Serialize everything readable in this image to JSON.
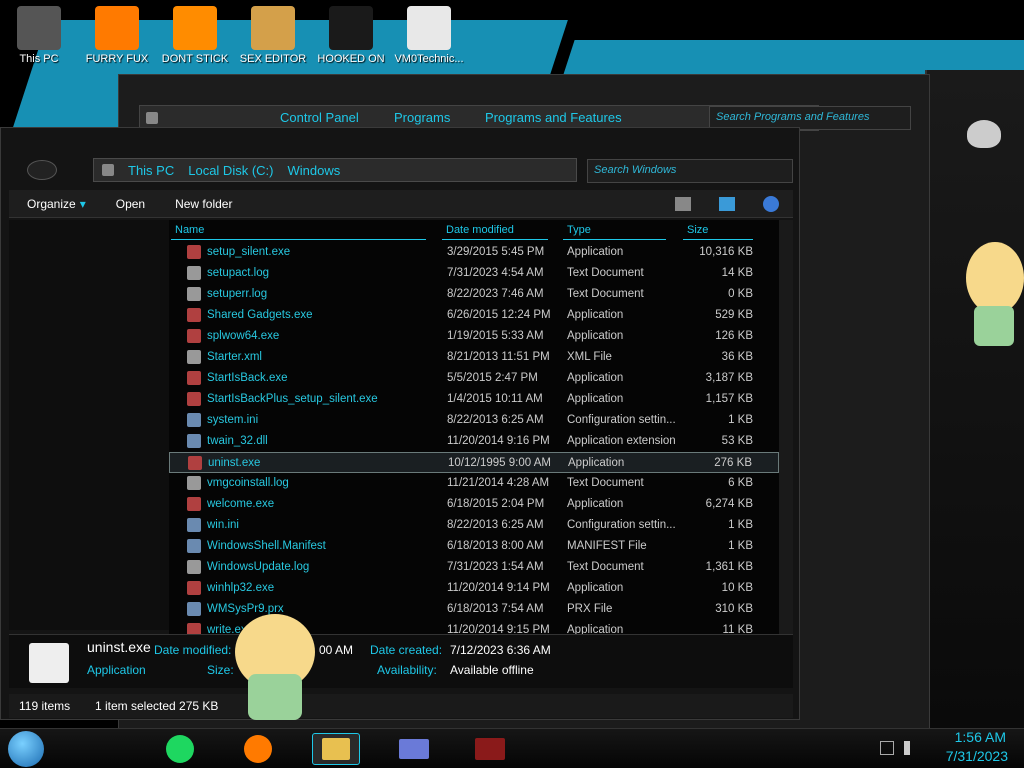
{
  "desktop": {
    "icons": [
      {
        "label": "This PC",
        "icon": "computer-icon",
        "color": "#555555"
      },
      {
        "label": "FURRY FUX",
        "icon": "firefox-icon",
        "color": "#ff7a00"
      },
      {
        "label": "DONT STICK",
        "icon": "vlc-icon",
        "color": "#ff8c00"
      },
      {
        "label": "SEX EDITOR",
        "icon": "hxd-icon",
        "color": "#d4a04a"
      },
      {
        "label": "HOOKED ON",
        "icon": "game-icon",
        "color": "#1a1a1a"
      },
      {
        "label": "VM0Technic...",
        "icon": "doctor-icon",
        "color": "#e8e8e8"
      }
    ]
  },
  "back_window": {
    "crumbs": [
      "Control Panel",
      "Programs",
      "Programs and Features"
    ],
    "search_placeholder": "Search Programs and Features"
  },
  "window": {
    "crumbs": [
      "This PC",
      "Local Disk (C:)",
      "Windows"
    ],
    "search_placeholder": "Search Windows",
    "toolbar": {
      "organize": "Organize",
      "open": "Open",
      "new_folder": "New folder"
    },
    "columns": {
      "name": "Name",
      "date": "Date modified",
      "type": "Type",
      "size": "Size"
    },
    "files": [
      {
        "name": "setup_silent.exe",
        "date": "3/29/2015 5:45 PM",
        "type": "Application",
        "size": "10,316 KB"
      },
      {
        "name": "setupact.log",
        "date": "7/31/2023 4:54 AM",
        "type": "Text Document",
        "size": "14 KB"
      },
      {
        "name": "setuperr.log",
        "date": "8/22/2023 7:46 AM",
        "type": "Text Document",
        "size": "0 KB"
      },
      {
        "name": "Shared Gadgets.exe",
        "date": "6/26/2015 12:24 PM",
        "type": "Application",
        "size": "529 KB"
      },
      {
        "name": "splwow64.exe",
        "date": "1/19/2015 5:33 AM",
        "type": "Application",
        "size": "126 KB"
      },
      {
        "name": "Starter.xml",
        "date": "8/21/2013 11:51 PM",
        "type": "XML File",
        "size": "36 KB"
      },
      {
        "name": "StartIsBack.exe",
        "date": "5/5/2015 2:47 PM",
        "type": "Application",
        "size": "3,187 KB"
      },
      {
        "name": "StartIsBackPlus_setup_silent.exe",
        "date": "1/4/2015 10:11 AM",
        "type": "Application",
        "size": "1,157 KB"
      },
      {
        "name": "system.ini",
        "date": "8/22/2013 6:25 AM",
        "type": "Configuration settin...",
        "size": "1 KB"
      },
      {
        "name": "twain_32.dll",
        "date": "11/20/2014 9:16 PM",
        "type": "Application extension",
        "size": "53 KB"
      },
      {
        "name": "uninst.exe",
        "date": "10/12/1995 9:00 AM",
        "type": "Application",
        "size": "276 KB"
      },
      {
        "name": "vmgcoinstall.log",
        "date": "11/21/2014 4:28 AM",
        "type": "Text Document",
        "size": "6 KB"
      },
      {
        "name": "welcome.exe",
        "date": "6/18/2015 2:04 PM",
        "type": "Application",
        "size": "6,274 KB"
      },
      {
        "name": "win.ini",
        "date": "8/22/2013 6:25 AM",
        "type": "Configuration settin...",
        "size": "1 KB"
      },
      {
        "name": "WindowsShell.Manifest",
        "date": "6/18/2013 8:00 AM",
        "type": "MANIFEST File",
        "size": "1 KB"
      },
      {
        "name": "WindowsUpdate.log",
        "date": "7/31/2023 1:54 AM",
        "type": "Text Document",
        "size": "1,361 KB"
      },
      {
        "name": "winhlp32.exe",
        "date": "11/20/2014 9:14 PM",
        "type": "Application",
        "size": "10 KB"
      },
      {
        "name": "WMSysPr9.prx",
        "date": "6/18/2013 7:54 AM",
        "type": "PRX File",
        "size": "310 KB"
      },
      {
        "name": "write.exe",
        "date": "11/20/2014 9:15 PM",
        "type": "Application",
        "size": "11 KB"
      }
    ],
    "details": {
      "filename": "uninst.exe",
      "kind": "Application",
      "date_modified_label": "Date modified:",
      "date_modified_value": "00 AM",
      "size_label": "Size:",
      "date_created_label": "Date created:",
      "date_created_value": "7/12/2023 6:36 AM",
      "availability_label": "Availability:",
      "availability_value": "Available offline"
    },
    "status": {
      "items": "119 items",
      "selected": "1 item selected  275 KB"
    }
  },
  "taskbar": {
    "time": "1:56 AM",
    "date": "7/31/2023"
  },
  "colors": {
    "accent": "#1ec8e8",
    "wallpaper_blue": "#1aa0c8",
    "alert_red": "#e02020"
  }
}
